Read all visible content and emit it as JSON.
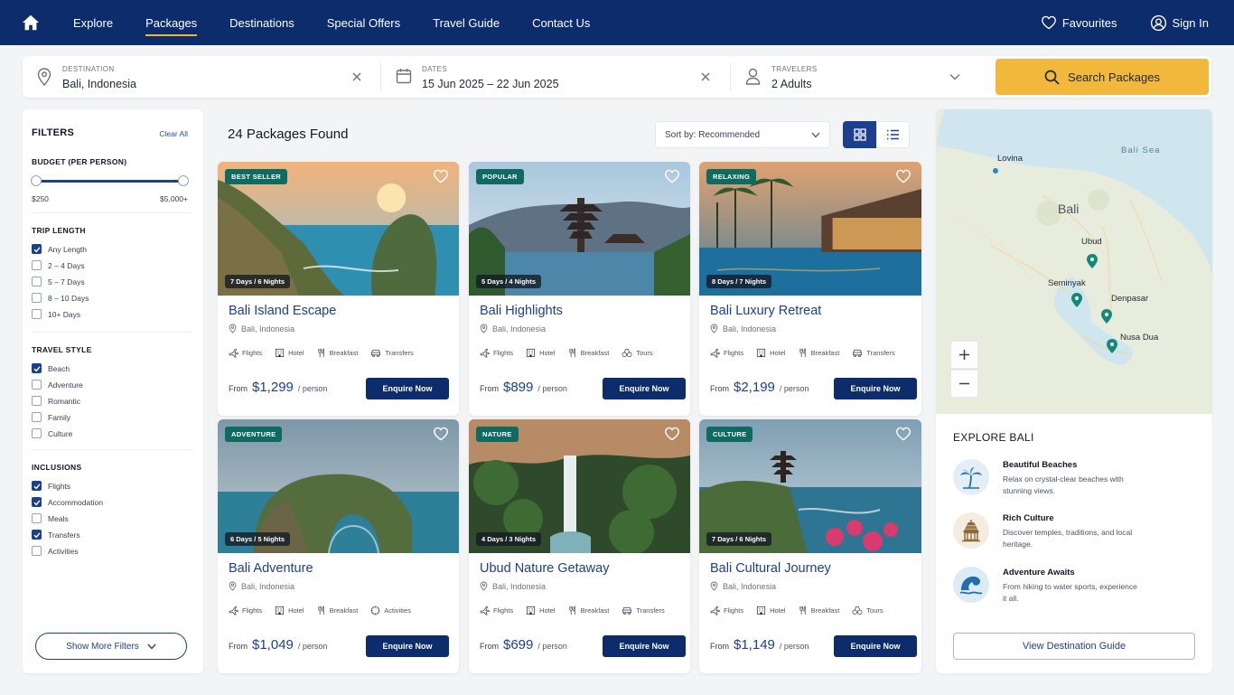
{
  "nav": {
    "links": [
      "Explore",
      "Packages",
      "Destinations",
      "Special Offers",
      "Travel Guide",
      "Contact Us"
    ],
    "active_index": 1,
    "favourites_label": "Favourites",
    "signin_label": "Sign In"
  },
  "search": {
    "destination_label": "DESTINATION",
    "destination_value": "Bali, Indonesia",
    "dates_label": "DATES",
    "dates_value": "15 Jun 2025  –  22 Jun 2025",
    "travelers_label": "TRAVELERS",
    "travelers_value": "2 Adults",
    "button_label": "Search Packages"
  },
  "filters": {
    "title": "FILTERS",
    "clear_all": "Clear All",
    "budget": {
      "title": "BUDGET (PER PERSON)",
      "min_label": "$250",
      "max_label": "$5,000+",
      "low_fraction": 0.0,
      "high_fraction": 1.0
    },
    "trip_length": {
      "title": "TRIP LENGTH",
      "options": [
        {
          "label": "Any Length",
          "checked": true
        },
        {
          "label": "2 – 4 Days",
          "checked": false
        },
        {
          "label": "5 – 7 Days",
          "checked": false
        },
        {
          "label": "8 – 10 Days",
          "checked": false
        },
        {
          "label": "10+ Days",
          "checked": false
        }
      ]
    },
    "travel_style": {
      "title": "TRAVEL STYLE",
      "options": [
        {
          "label": "Beach",
          "checked": true
        },
        {
          "label": "Adventure",
          "checked": false
        },
        {
          "label": "Romantic",
          "checked": false
        },
        {
          "label": "Family",
          "checked": false
        },
        {
          "label": "Culture",
          "checked": false
        }
      ]
    },
    "inclusions": {
      "title": "INCLUSIONS",
      "options": [
        {
          "label": "Flights",
          "checked": true
        },
        {
          "label": "Accommodation",
          "checked": true
        },
        {
          "label": "Meals",
          "checked": false
        },
        {
          "label": "Transfers",
          "checked": true
        },
        {
          "label": "Activities",
          "checked": false
        }
      ]
    },
    "show_more": "Show More Filters"
  },
  "results": {
    "count_label": "24 Packages Found",
    "sort_label": "Sort by: Recommended",
    "packages": [
      {
        "badge": "BEST SELLER",
        "duration": "7 Days / 6 Nights",
        "title": "Bali Island Escape",
        "location": "Bali, Indonesia",
        "amenities": [
          "Flights",
          "Hotel",
          "Breakfast",
          "Transfers"
        ],
        "from": "From",
        "price": "$1,299",
        "per": "/ person",
        "cta": "Enquire Now",
        "image": "cliff"
      },
      {
        "badge": "POPULAR",
        "duration": "5 Days / 4 Nights",
        "title": "Bali Highlights",
        "location": "Bali, Indonesia",
        "amenities": [
          "Flights",
          "Hotel",
          "Breakfast",
          "Tours"
        ],
        "from": "From",
        "price": "$899",
        "per": "/ person",
        "cta": "Enquire Now",
        "image": "temple"
      },
      {
        "badge": "RELAXING",
        "duration": "8 Days / 7 Nights",
        "title": "Bali Luxury Retreat",
        "location": "Bali, Indonesia",
        "amenities": [
          "Flights",
          "Hotel",
          "Breakfast",
          "Transfers"
        ],
        "from": "From",
        "price": "$2,199",
        "per": "/ person",
        "cta": "Enquire Now",
        "image": "pool"
      },
      {
        "badge": "ADVENTURE",
        "duration": "6 Days / 5 Nights",
        "title": "Bali Adventure",
        "location": "Bali, Indonesia",
        "amenities": [
          "Flights",
          "Hotel",
          "Breakfast",
          "Activities"
        ],
        "from": "From",
        "price": "$1,049",
        "per": "/ person",
        "cta": "Enquire Now",
        "image": "arch"
      },
      {
        "badge": "NATURE",
        "duration": "4 Days / 3 Nights",
        "title": "Ubud Nature Getaway",
        "location": "Bali, Indonesia",
        "amenities": [
          "Flights",
          "Hotel",
          "Breakfast",
          "Transfers"
        ],
        "from": "From",
        "price": "$699",
        "per": "/ person",
        "cta": "Enquire Now",
        "image": "waterfall"
      },
      {
        "badge": "CULTURE",
        "duration": "7 Days / 6 Nights",
        "title": "Bali Cultural Journey",
        "location": "Bali, Indonesia",
        "amenities": [
          "Flights",
          "Hotel",
          "Breakfast",
          "Tours"
        ],
        "from": "From",
        "price": "$1,149",
        "per": "/ person",
        "cta": "Enquire Now",
        "image": "seatemple"
      }
    ]
  },
  "map": {
    "labels": [
      "Bali Sea",
      "Lovina",
      "Bali",
      "Ubud",
      "Seminyak",
      "Denpasar",
      "Nusa Dua"
    ]
  },
  "explore": {
    "title": "EXPLORE BALI",
    "items": [
      {
        "title": "Beautiful Beaches",
        "desc": "Relax on crystal-clear beaches with stunning views.",
        "icon": "palm-icon"
      },
      {
        "title": "Rich Culture",
        "desc": "Discover temples, traditions, and local heritage.",
        "icon": "temple-icon"
      },
      {
        "title": "Adventure Awaits",
        "desc": "From hiking to water sports, experience it all.",
        "icon": "wave-icon"
      }
    ],
    "guide_button": "View Destination Guide"
  },
  "colors": {
    "navy": "#0d2c6b",
    "accent": "#f2b83c",
    "badge": "#0f6b61",
    "link": "#1d3f8f"
  }
}
